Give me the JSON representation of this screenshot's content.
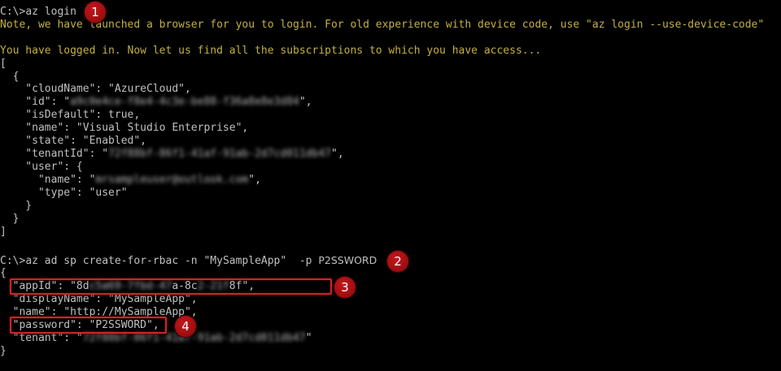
{
  "terminal": {
    "colors": {
      "background": "#000000",
      "text": "#c0c0c0",
      "info_text": "#c3b040",
      "highlight": "#c62828",
      "badge": "#b3141a"
    },
    "lines": {
      "l1_prompt": "C:\\>",
      "l1_cmd": "az login",
      "l2_note": "Note, we have launched a browser for you to login. For old experience with device code, use \"az login --use-device-code\"",
      "l3_logged": "You have logged in. Now let us find all the subscriptions to which you have access...",
      "l4": "[",
      "l5": "  {",
      "l6": "    \"cloudName\": \"AzureCloud\",",
      "l7_key": "    \"id\": \"",
      "l7_val": "a9c0e4ce-f8e4-4c3e-be88-f36a8e8e3d84",
      "l7_end": "\",",
      "l8": "    \"isDefault\": true,",
      "l9": "    \"name\": \"Visual Studio Enterprise\",",
      "l10": "    \"state\": \"Enabled\",",
      "l11_key": "    \"tenantId\": \"",
      "l11_val": "72f88bf-86f1-41af-91ab-2d7cd011db47",
      "l11_end": "\",",
      "l12": "    \"user\": {",
      "l13_key": "      \"name\": \"",
      "l13_val": "mrsampleuser@outlook.com",
      "l13_end": "\",",
      "l14": "      \"type\": \"user\"",
      "l15": "    }",
      "l16": "  }",
      "l17": "]",
      "l18_prompt": "C:\\>",
      "l18_cmd": "az ad sp create-for-rbac -n \"MySampleApp\"  -p ",
      "l18_pw": "P2SSWORD",
      "l19": "{",
      "l20_key": "  \"appId\": \"8d",
      "l20_val": "c5a69-7fbd-47",
      "l20_mid": "a-8c",
      "l20_val2": "2-21f",
      "l20_mid2": "8f",
      "l20_end": "\",",
      "l21": "  \"displayName\": \"MySampleApp\",",
      "l22": "  \"name\": \"http://MySampleApp\",",
      "l23": "  \"password\": \"P2SSWORD\",",
      "l24_key": "  \"tenant\": \"",
      "l24_val": "72f88bf-86f1-41af-91ab-2d7cd011db47",
      "l24_end": "\"",
      "l25": "}"
    },
    "badges": [
      "1",
      "2",
      "3",
      "4"
    ]
  }
}
